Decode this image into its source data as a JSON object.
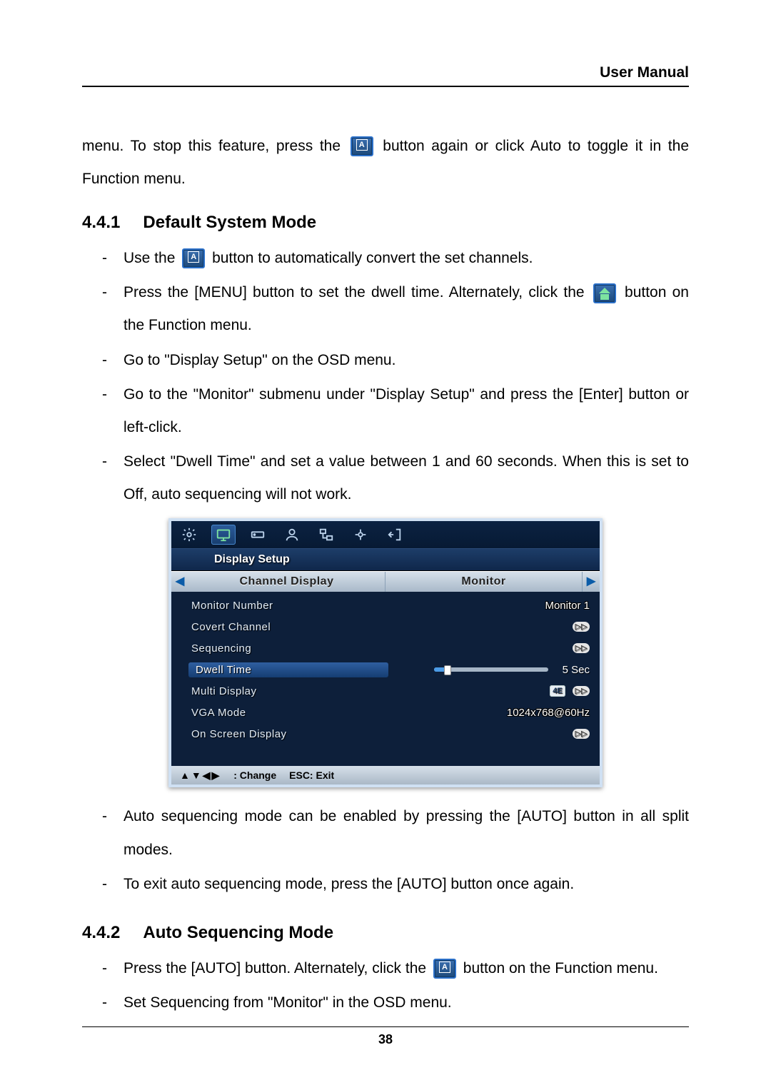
{
  "header": {
    "title": "User Manual"
  },
  "intro": {
    "part1": "menu. To stop this feature, press the ",
    "part2": " button again or click Auto to toggle it in the Function menu."
  },
  "section441": {
    "number": "4.4.1",
    "title": "Default System Mode",
    "items": [
      {
        "pre": "Use the ",
        "icon": "auto",
        "post": " button to automatically convert the set channels."
      },
      {
        "pre": "Press the [MENU] button to set the dwell time. Alternately, click the ",
        "icon": "home",
        "post": " button on the Function menu."
      },
      {
        "text": "Go to \"Display Setup\" on the OSD menu."
      },
      {
        "text": "Go to the \"Monitor\" submenu under \"Display Setup\" and press the [Enter] button or left-click."
      },
      {
        "text": "Select \"Dwell Time\" and set a value between 1 and 60 seconds. When this is set to Off, auto sequencing will not work."
      }
    ],
    "afterItems": [
      "Auto sequencing mode can be enabled by pressing the [AUTO] button in all split modes.",
      "To exit auto sequencing mode, press the [AUTO] button once again."
    ]
  },
  "osd": {
    "title": "Display Setup",
    "tabs": {
      "left": "Channel Display",
      "right": "Monitor"
    },
    "rows": {
      "monitorNumber": {
        "label": "Monitor Number",
        "value": "Monitor 1"
      },
      "covertChannel": {
        "label": "Covert Channel"
      },
      "sequencing": {
        "label": "Sequencing"
      },
      "dwellTime": {
        "label": "Dwell Time",
        "value": "5 Sec",
        "sliderPercent": 12
      },
      "multiDisplay": {
        "label": "Multi Display",
        "badge": "4E"
      },
      "vgaMode": {
        "label": "VGA Mode",
        "value": "1024x768@60Hz"
      },
      "onScreen": {
        "label": "On Screen Display"
      }
    },
    "footer": {
      "change": ": Change",
      "exit": "ESC: Exit"
    }
  },
  "section442": {
    "number": "4.4.2",
    "title": "Auto Sequencing Mode",
    "items": [
      {
        "pre": "Press the [AUTO] button. Alternately, click the ",
        "icon": "auto",
        "post": " button on the Function menu."
      },
      {
        "text": "Set Sequencing from \"Monitor\" in the OSD menu."
      }
    ]
  },
  "footer": {
    "page": "38"
  }
}
